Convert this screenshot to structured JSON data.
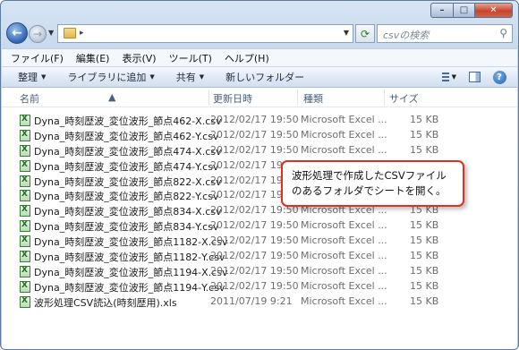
{
  "window": {
    "caption_buttons": {
      "minimize": "–",
      "maximize": "□",
      "close": "✕"
    }
  },
  "address": {
    "back_icon": "back-arrow-icon",
    "forward_icon": "forward-arrow-icon",
    "path_separator": "▸",
    "refresh_icon": "refresh-icon",
    "search_placeholder": "csvの検索"
  },
  "menu": {
    "items": [
      "ファイル(F)",
      "編集(E)",
      "表示(V)",
      "ツール(T)",
      "ヘルプ(H)"
    ]
  },
  "commands": {
    "organize": "整理",
    "add_library": "ライブラリに追加",
    "share": "共有",
    "new_folder": "新しいフォルダー"
  },
  "columns": {
    "name": "名前",
    "modified": "更新日時",
    "type": "種類",
    "size": "サイズ"
  },
  "files": [
    {
      "name": "Dyna_時刻歴波_変位波形_節点462-X.csv",
      "modified": "2012/02/17 19:50",
      "type": "Microsoft Excel ...",
      "size": "15 KB"
    },
    {
      "name": "Dyna_時刻歴波_変位波形_節点462-Y.csv",
      "modified": "2012/02/17 19:50",
      "type": "Microsoft Excel ...",
      "size": "15 KB"
    },
    {
      "name": "Dyna_時刻歴波_変位波形_節点474-X.csv",
      "modified": "2012/02/17 19:50",
      "type": "Microsoft Excel ...",
      "size": "15 KB"
    },
    {
      "name": "Dyna_時刻歴波_変位波形_節点474-Y.csv",
      "modified": "2012/02/17 19:",
      "type": "",
      "size": ""
    },
    {
      "name": "Dyna_時刻歴波_変位波形_節点822-X.csv",
      "modified": "2012/02/17 19:",
      "type": "",
      "size": ""
    },
    {
      "name": "Dyna_時刻歴波_変位波形_節点822-Y.csv",
      "modified": "2012/02/17 19:",
      "type": "",
      "size": ""
    },
    {
      "name": "Dyna_時刻歴波_変位波形_節点834-X.csv",
      "modified": "2012/02/17 19:50",
      "type": "Microsoft Excel ...",
      "size": "15 KB"
    },
    {
      "name": "Dyna_時刻歴波_変位波形_節点834-Y.csv",
      "modified": "2012/02/17 19:50",
      "type": "Microsoft Excel ...",
      "size": "15 KB"
    },
    {
      "name": "Dyna_時刻歴波_変位波形_節点1182-X.csv",
      "modified": "2012/02/17 19:50",
      "type": "Microsoft Excel ...",
      "size": "15 KB"
    },
    {
      "name": "Dyna_時刻歴波_変位波形_節点1182-Y.csv",
      "modified": "2012/02/17 19:50",
      "type": "Microsoft Excel ...",
      "size": "15 KB"
    },
    {
      "name": "Dyna_時刻歴波_変位波形_節点1194-X.csv",
      "modified": "2012/02/17 19:50",
      "type": "Microsoft Excel ...",
      "size": "15 KB"
    },
    {
      "name": "Dyna_時刻歴波_変位波形_節点1194-Y.csv",
      "modified": "2012/02/17 19:50",
      "type": "Microsoft Excel ...",
      "size": "15 KB"
    },
    {
      "name": "波形処理CSV読込(時刻歴用).xls",
      "modified": "2011/07/19 9:21",
      "type": "Microsoft Excel ...",
      "size": "15 KB"
    }
  ],
  "callout": {
    "line1": "波形処理で作成したCSVファイル",
    "line2": "のあるフォルダでシートを開く。"
  },
  "colors": {
    "callout_border": "#e0301e",
    "excel_icon_green": "#1f6b22",
    "window_frame": "#c3d6ec"
  }
}
